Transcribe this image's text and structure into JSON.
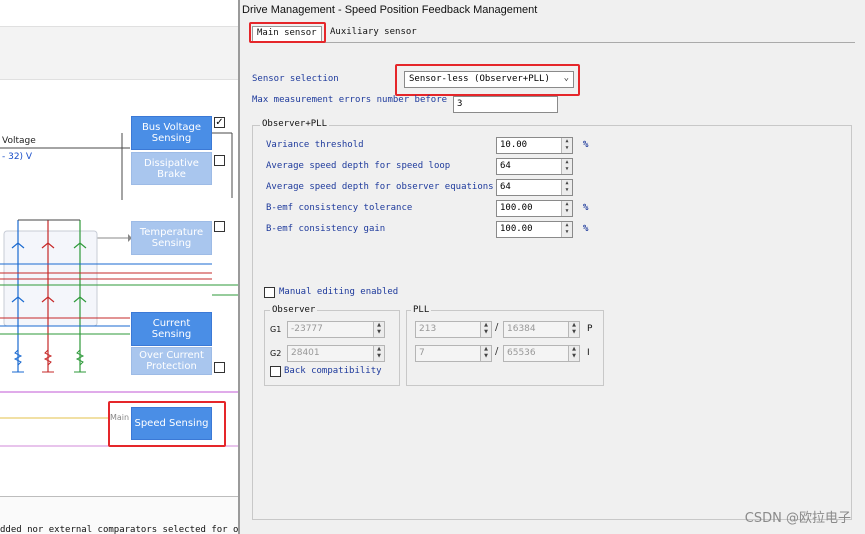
{
  "left_diagram": {
    "voltage_label": "Voltage",
    "voltage_range": "- 32) V",
    "blocks": {
      "bus_voltage_sensing": "Bus Voltage Sensing",
      "dissipative_brake": "Dissipative Brake",
      "temperature_sensing": "Temperature Sensing",
      "current_sensing": "Current Sensing",
      "over_current_protection": "Over Current Protection",
      "speed_sensing": "Speed Sensing"
    },
    "main_label": "Main",
    "bus_voltage_checked": "✓",
    "bottom_text": "dded nor external comparators selected for over"
  },
  "dialog": {
    "title": "Drive Management - Speed Position Feedback Management",
    "tabs": [
      "Main sensor",
      "Auxiliary sensor"
    ],
    "sensor_selection_label": "Sensor selection",
    "sensor_selection_value": "Sensor-less (Observer+PLL)",
    "max_errors_label": "Max measurement errors number before",
    "max_errors_value": "3",
    "observer_pll_group": "Observer+PLL",
    "params": [
      {
        "label": "Variance threshold",
        "value": "10.00",
        "unit": "%"
      },
      {
        "label": "Average speed depth for speed loop",
        "value": "64",
        "unit": ""
      },
      {
        "label": "Average speed depth for observer equations",
        "value": "64",
        "unit": ""
      },
      {
        "label": "B-emf consistency tolerance",
        "value": "100.00",
        "unit": "%"
      },
      {
        "label": "B-emf consistency gain",
        "value": "100.00",
        "unit": "%"
      }
    ],
    "manual_editing_label": "Manual editing enabled",
    "observer_group": "Observer",
    "g1_label": "G1",
    "g1_value": "-23777",
    "g2_label": "G2",
    "g2_value": "28401",
    "back_compat_label": "Back compatibility",
    "pll_group": "PLL",
    "p_num": "213",
    "p_den": "16384",
    "p_label": "P",
    "i_num": "7",
    "i_den": "65536",
    "i_label": "I",
    "slash": "/"
  },
  "watermark": "CSDN @欧拉电子",
  "colors": {
    "block_blue": "#4a8ee6",
    "block_light": "#a9c6ee",
    "highlight_red": "#e5262a",
    "label_blue": "#1e3a9c"
  }
}
